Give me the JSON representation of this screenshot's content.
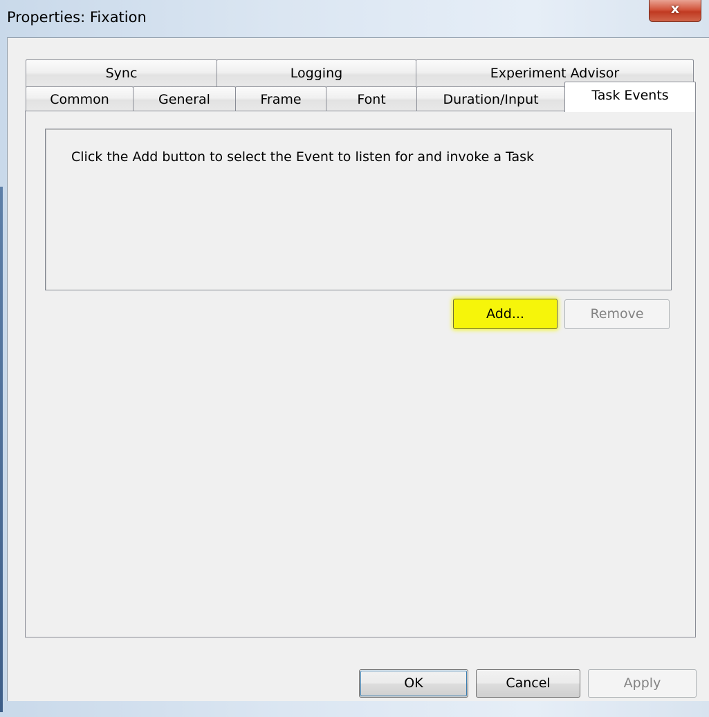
{
  "window": {
    "title": "Properties: Fixation",
    "close_glyph": "x"
  },
  "tabs": {
    "row1": [
      {
        "id": "sync",
        "label": "Sync"
      },
      {
        "id": "logging",
        "label": "Logging"
      },
      {
        "id": "experiment-advisor",
        "label": "Experiment Advisor"
      }
    ],
    "row2": [
      {
        "id": "common",
        "label": "Common"
      },
      {
        "id": "general",
        "label": "General"
      },
      {
        "id": "frame",
        "label": "Frame"
      },
      {
        "id": "font",
        "label": "Font"
      },
      {
        "id": "duration-input",
        "label": "Duration/Input"
      },
      {
        "id": "task-events",
        "label": "Task Events",
        "selected": true
      }
    ]
  },
  "task_events": {
    "instruction": "Click the Add button to select the Event to listen for and invoke a Task",
    "add_label": "Add...",
    "remove_label": "Remove",
    "remove_enabled": false,
    "add_highlight_color": "#f6f50a"
  },
  "footer": {
    "ok_label": "OK",
    "cancel_label": "Cancel",
    "apply_label": "Apply",
    "apply_enabled": false
  }
}
